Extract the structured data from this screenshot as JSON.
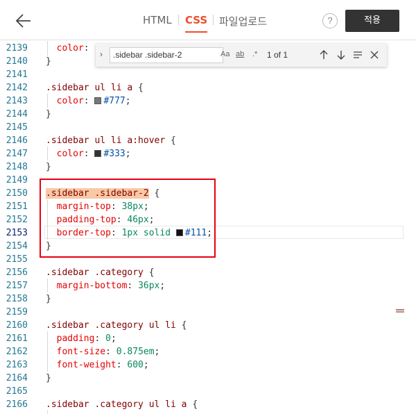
{
  "header": {
    "tabs": [
      "HTML",
      "CSS",
      "파일업로드"
    ],
    "help_label": "?",
    "apply_label": "적용"
  },
  "find": {
    "query": ".sidebar .sidebar-2",
    "opt_case": "Aa",
    "opt_word": "ab",
    "opt_regex": ".*",
    "count": "1 of 1"
  },
  "lines": [
    {
      "n": "2139",
      "frag": "  color: "
    },
    {
      "n": "2140",
      "frag": "}"
    },
    {
      "n": "2141",
      "frag": ""
    },
    {
      "n": "2142",
      "frag": ".sidebar ul li a {"
    },
    {
      "n": "2143",
      "prop": "color",
      "val": "#777"
    },
    {
      "n": "2144",
      "frag": "}"
    },
    {
      "n": "2145",
      "frag": ""
    },
    {
      "n": "2146",
      "frag": ".sidebar ul li a:hover {"
    },
    {
      "n": "2147",
      "prop": "color",
      "val": "#333"
    },
    {
      "n": "2148",
      "frag": "}"
    },
    {
      "n": "2149",
      "frag": ""
    },
    {
      "n": "2150",
      "frag": ".sidebar .sidebar-2"
    },
    {
      "n": "2151",
      "prop": "margin-top",
      "val": "38px"
    },
    {
      "n": "2152",
      "prop": "padding-top",
      "val": "46px"
    },
    {
      "n": "2153",
      "prop": "border-top",
      "val": "1px solid",
      "val2": "#111"
    },
    {
      "n": "2154",
      "frag": "}"
    },
    {
      "n": "2155",
      "frag": ""
    },
    {
      "n": "2156",
      "frag": ".sidebar .category {"
    },
    {
      "n": "2157",
      "prop": "margin-bottom",
      "val": "36px"
    },
    {
      "n": "2158",
      "frag": "}"
    },
    {
      "n": "2159",
      "frag": ""
    },
    {
      "n": "2160",
      "frag": ".sidebar .category ul li {"
    },
    {
      "n": "2161",
      "prop": "padding",
      "val": "0"
    },
    {
      "n": "2162",
      "prop": "font-size",
      "val": "0.875em"
    },
    {
      "n": "2163",
      "prop": "font-weight",
      "val": "600"
    },
    {
      "n": "2164",
      "frag": "}"
    },
    {
      "n": "2165",
      "frag": ""
    },
    {
      "n": "2166",
      "frag": ".sidebar .category ul li a {"
    }
  ],
  "colors": {
    "accent": "#ee4d2d",
    "highlight_box": "#e60012",
    "swatch_777": "#777777",
    "swatch_333": "#333333",
    "swatch_111": "#111111"
  }
}
